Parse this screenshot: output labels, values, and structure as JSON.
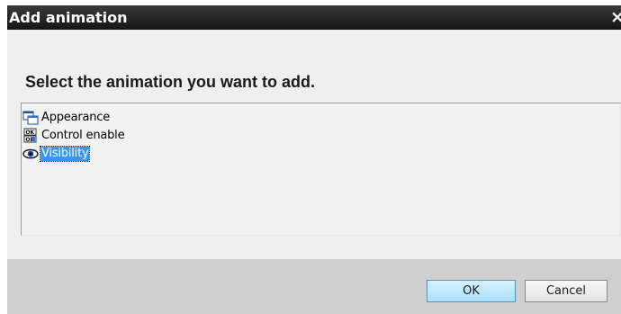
{
  "dialog": {
    "title": "Add animation",
    "close_glyph": "×",
    "prompt": "Select the animation you want to add.",
    "items": [
      {
        "label": "Appearance",
        "icon": "appearance-icon",
        "selected": false
      },
      {
        "label": "Control enable",
        "icon": "control-enable-icon",
        "selected": false
      },
      {
        "label": "Visibility",
        "icon": "visibility-eye-icon",
        "selected": true
      }
    ],
    "buttons": {
      "ok": "OK",
      "cancel": "Cancel"
    },
    "colors": {
      "titlebar": "#1e1e1e",
      "selection": "#3399ff",
      "ok_button": "#bfe7fb"
    }
  }
}
